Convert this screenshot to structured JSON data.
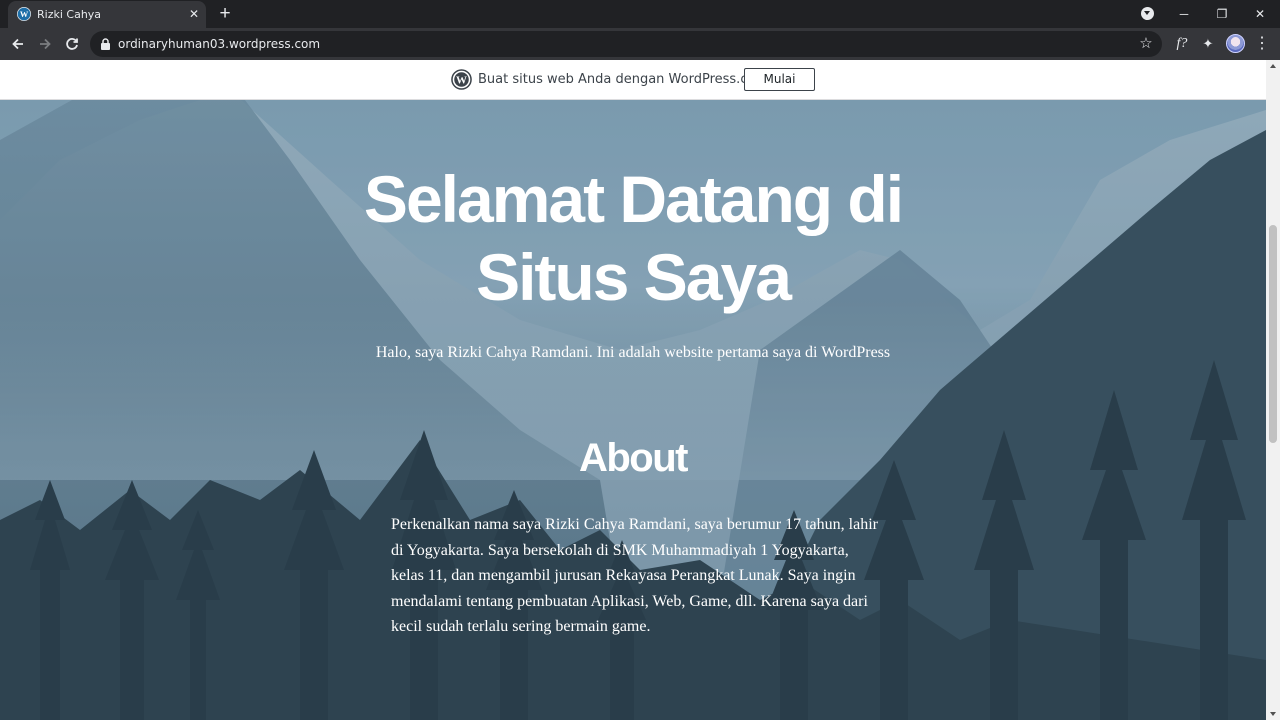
{
  "browser": {
    "tab_title": "Rizki Cahya",
    "tab_close": "✕",
    "new_tab": "+",
    "url": "ordinaryhuman03.wordpress.com",
    "window_controls": {
      "minimize": "─",
      "maximize": "❐",
      "close": "✕"
    },
    "toolbar_icons": {
      "font_ext": "f?",
      "extensions": "✦",
      "menu": "⋮",
      "bookmark": "☆"
    }
  },
  "banner": {
    "text": "Buat situs web Anda dengan WordPress.com",
    "button_label": "Mulai"
  },
  "hero": {
    "title": "Selamat Datang di Situs Saya",
    "subtitle": "Halo, saya Rizki Cahya Ramdani. Ini adalah website pertama saya di WordPress"
  },
  "about": {
    "heading": "About",
    "body": "Perkenalkan nama saya Rizki Cahya Ramdani, saya berumur 17 tahun, lahir di Yogyakarta. Saya bersekolah di SMK Muhammadiyah 1 Yogyakarta, kelas 11, dan mengambil jurusan Rekayasa Perangkat Lunak. Saya ingin mendalami tentang pembuatan Aplikasi, Web, Game, dll. Karena saya dari kecil sudah terlalu sering bermain game."
  },
  "colors": {
    "chrome_dark": "#202124",
    "chrome_toolbar": "#35363a",
    "sky": "#9bb9cb",
    "forest": "#2f4350"
  }
}
